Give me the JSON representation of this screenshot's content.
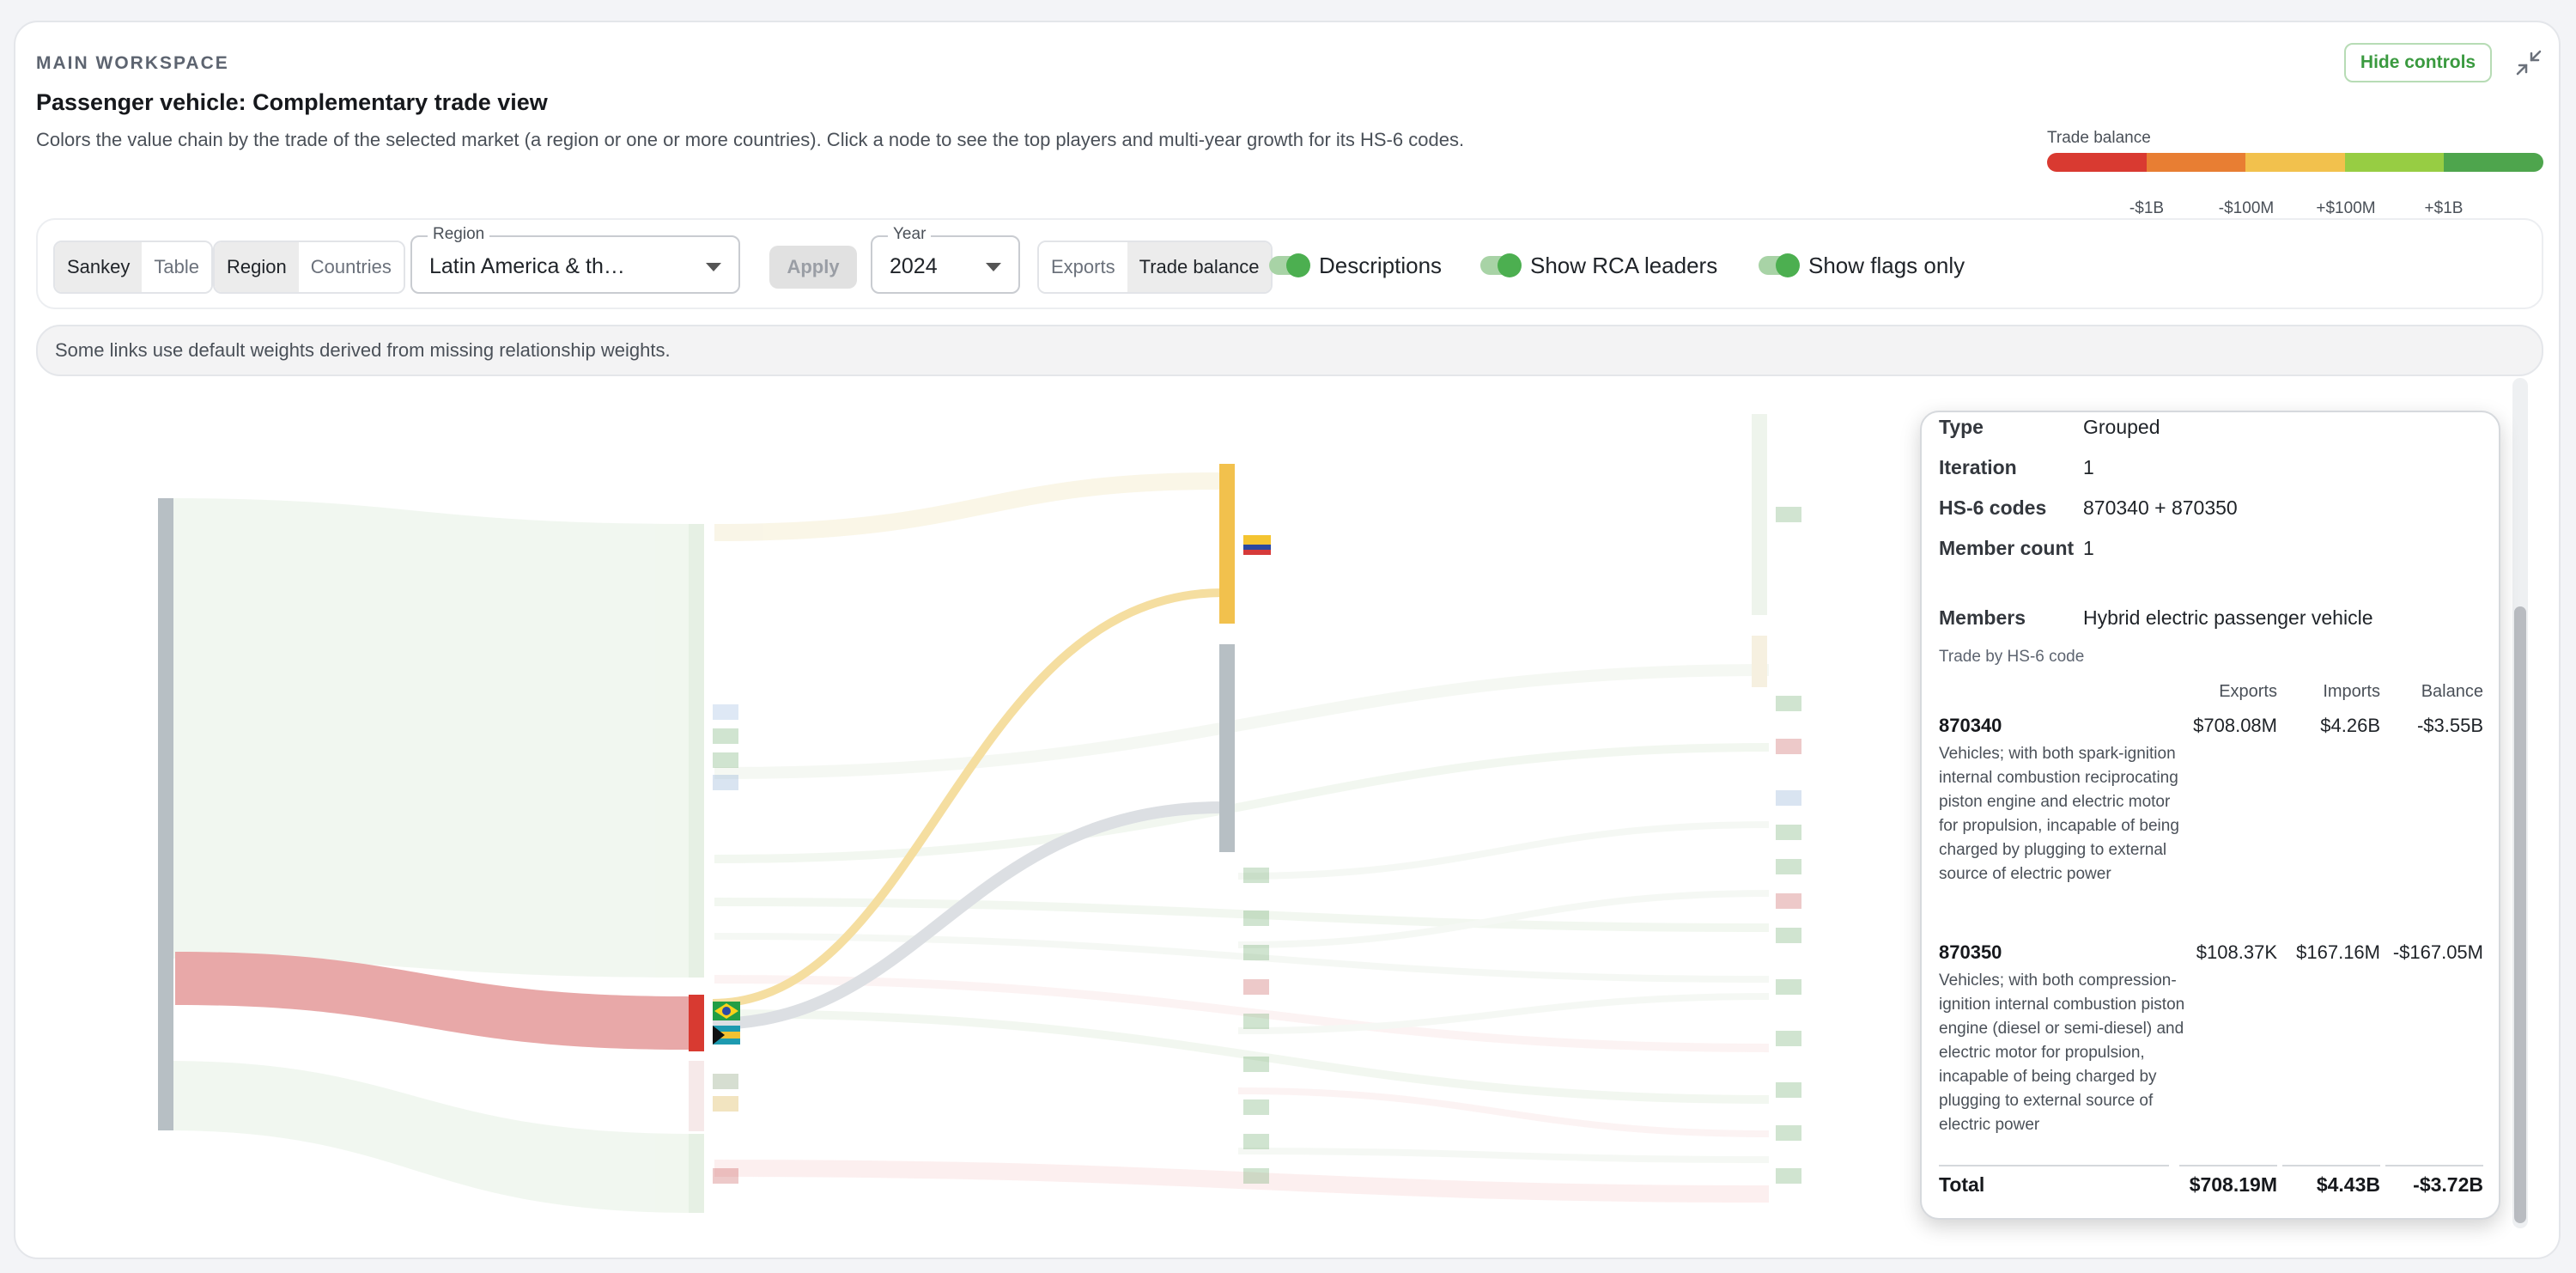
{
  "header": {
    "eyebrow": "MAIN WORKSPACE",
    "title": "Passenger vehicle: Complementary trade view",
    "description": "Colors the value chain by the trade of the selected market (a region or one or more countries). Click a node to see the top players and multi-year growth for its HS-6 codes.",
    "hide_controls_label": "Hide controls",
    "collapse_icon": "collapse-arrows-icon"
  },
  "legend": {
    "title": "Trade balance",
    "colors": [
      "#d93a31",
      "#e87e33",
      "#f2c14d",
      "#97cd43",
      "#4ea54d"
    ],
    "labels": [
      "-$1B",
      "-$100M",
      "+$100M",
      "+$1B"
    ]
  },
  "controls": {
    "view_options": [
      "Sankey",
      "Table"
    ],
    "view_selected": "Sankey",
    "scope_options": [
      "Region",
      "Countries"
    ],
    "scope_selected": "Region",
    "region_label": "Region",
    "region_value": "Latin America & th…",
    "apply_label": "Apply",
    "year_label": "Year",
    "year_value": "2024",
    "metric_options": [
      "Exports",
      "Trade balance"
    ],
    "metric_selected": "Trade balance",
    "toggles": [
      {
        "label": "Descriptions",
        "on": true
      },
      {
        "label": "Show RCA leaders",
        "on": true
      },
      {
        "label": "Show flags only",
        "on": true
      }
    ]
  },
  "notice": "Some links use default weights derived from missing relationship weights.",
  "tooltip": {
    "rows": [
      {
        "key": "Type",
        "value": "Grouped"
      },
      {
        "key": "Iteration",
        "value": "1"
      },
      {
        "key": "HS-6 codes",
        "value": "870340 + 870350"
      },
      {
        "key": "Member count",
        "value": "1"
      },
      {
        "key": "Members",
        "value": "Hybrid electric passenger vehicle"
      }
    ],
    "subtitle": "Trade by HS-6 code",
    "columns": [
      "Exports",
      "Imports",
      "Balance"
    ],
    "codes": [
      {
        "code": "870340",
        "exports": "$708.08M",
        "imports": "$4.26B",
        "balance": "-$3.55B",
        "description": "Vehicles; with both spark-ignition internal combustion reciprocating piston engine and electric motor for propulsion, incapable of being charged by plugging to external source of electric power"
      },
      {
        "code": "870350",
        "exports": "$108.37K",
        "imports": "$167.16M",
        "balance": "-$167.05M",
        "description": "Vehicles; with both compression-ignition internal combustion piston engine (diesel or semi-diesel) and electric motor for propulsion, incapable of being charged by plugging to external source of electric power"
      }
    ],
    "total": {
      "label": "Total",
      "exports": "$708.19M",
      "imports": "$4.43B",
      "balance": "-$3.72B"
    }
  }
}
